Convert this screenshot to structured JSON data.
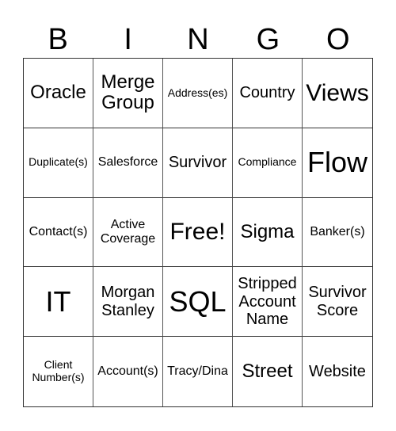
{
  "header": [
    "B",
    "I",
    "N",
    "G",
    "O"
  ],
  "cells": [
    {
      "text": "Oracle",
      "size": "s-lg"
    },
    {
      "text": "Merge Group",
      "size": "s-lg"
    },
    {
      "text": "Address(es)",
      "size": "s-xs"
    },
    {
      "text": "Country",
      "size": "s-md"
    },
    {
      "text": "Views",
      "size": "s-xl"
    },
    {
      "text": "Duplicate(s)",
      "size": "s-xs"
    },
    {
      "text": "Salesforce",
      "size": "s-sm"
    },
    {
      "text": "Survivor",
      "size": "s-md"
    },
    {
      "text": "Compliance",
      "size": "s-xs"
    },
    {
      "text": "Flow",
      "size": "s-xxl"
    },
    {
      "text": "Contact(s)",
      "size": "s-sm"
    },
    {
      "text": "Active Coverage",
      "size": "s-sm"
    },
    {
      "text": "Free!",
      "size": "s-xl"
    },
    {
      "text": "Sigma",
      "size": "s-lg"
    },
    {
      "text": "Banker(s)",
      "size": "s-sm"
    },
    {
      "text": "IT",
      "size": "s-xxl"
    },
    {
      "text": "Morgan Stanley",
      "size": "s-md"
    },
    {
      "text": "SQL",
      "size": "s-xxl"
    },
    {
      "text": "Stripped Account Name",
      "size": "s-md"
    },
    {
      "text": "Survivor Score",
      "size": "s-md"
    },
    {
      "text": "Client Number(s)",
      "size": "s-xs"
    },
    {
      "text": "Account(s)",
      "size": "s-sm"
    },
    {
      "text": "Tracy/Dina",
      "size": "s-sm"
    },
    {
      "text": "Street",
      "size": "s-lg"
    },
    {
      "text": "Website",
      "size": "s-md"
    }
  ]
}
